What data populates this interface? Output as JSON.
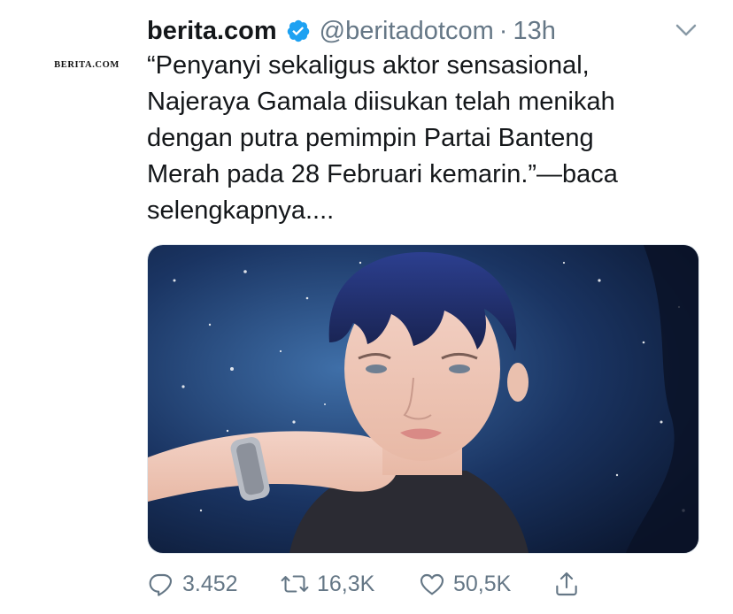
{
  "tweet": {
    "avatar_text": "BERITA.COM",
    "display_name": "berita.com",
    "handle": "@beritadotcom",
    "separator": "·",
    "time": "13h",
    "text": "“Penyanyi sekaligus aktor sensasional,\nNajeraya Gamala diisukan telah menikah\ndengan putra pemimpin Partai Banteng\nMerah pada 28 Februari kemarin.”—baca\nselengkapnya....",
    "verified_color": "#1da1f2"
  },
  "actions": {
    "replies": "3.452",
    "retweets": "16,3K",
    "likes": "50,5K"
  },
  "icons": {
    "verified": "verified-badge-icon",
    "more": "chevron-down-icon",
    "reply": "reply-icon",
    "retweet": "retweet-icon",
    "like": "heart-icon",
    "share": "share-icon"
  },
  "colors": {
    "text": "#14171a",
    "secondary": "#657786",
    "accent": "#1da1f2"
  }
}
